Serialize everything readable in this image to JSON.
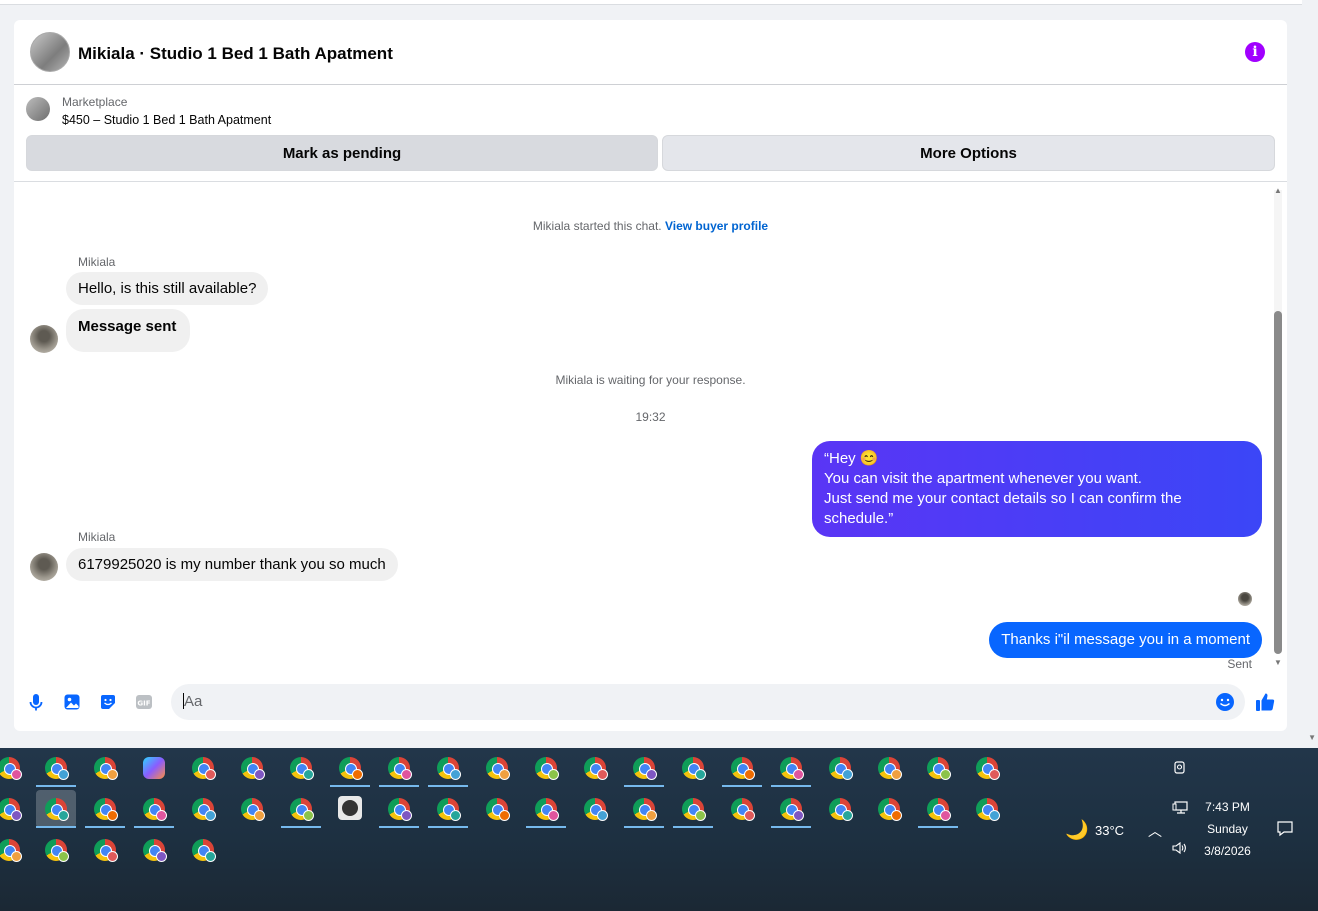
{
  "header": {
    "title": "Mikiala · Studio 1 Bed 1 Bath Apatment"
  },
  "listing": {
    "source": "Marketplace",
    "price_title": "$450 – Studio 1 Bed 1 Bath Apatment",
    "mark_pending_label": "Mark as pending",
    "more_options_label": "More Options"
  },
  "chat": {
    "started_text": "Mikiala started this chat.",
    "view_profile_link": "View buyer profile",
    "sender_name": "Mikiala",
    "msg1": "Hello, is this still available?",
    "msg2": "Message sent",
    "waiting_text": "Mikiala is waiting for your response.",
    "timestamp": "19:32",
    "out1_line1": "“Hey 😊",
    "out1_line2": "You can visit the apartment whenever you want.",
    "out1_line3": "Just send me your contact details so I can confirm the schedule.”",
    "sender_name2": "Mikiala",
    "msg3": "6179925020 is my number thank you so much",
    "out2": "Thanks i\"il message you in a moment",
    "sent_status": "Sent"
  },
  "composer": {
    "placeholder": "Aa"
  },
  "taskbar": {
    "weather_temp": "33°C",
    "time": "7:43 PM",
    "day": "Sunday",
    "date": "3/8/2026"
  },
  "colors": {
    "accent_blue": "#0866ff",
    "out_bubble_gradient_start": "#4a3cf5",
    "info_purple": "#a100ff",
    "in_bubble": "#f0f0f0"
  }
}
